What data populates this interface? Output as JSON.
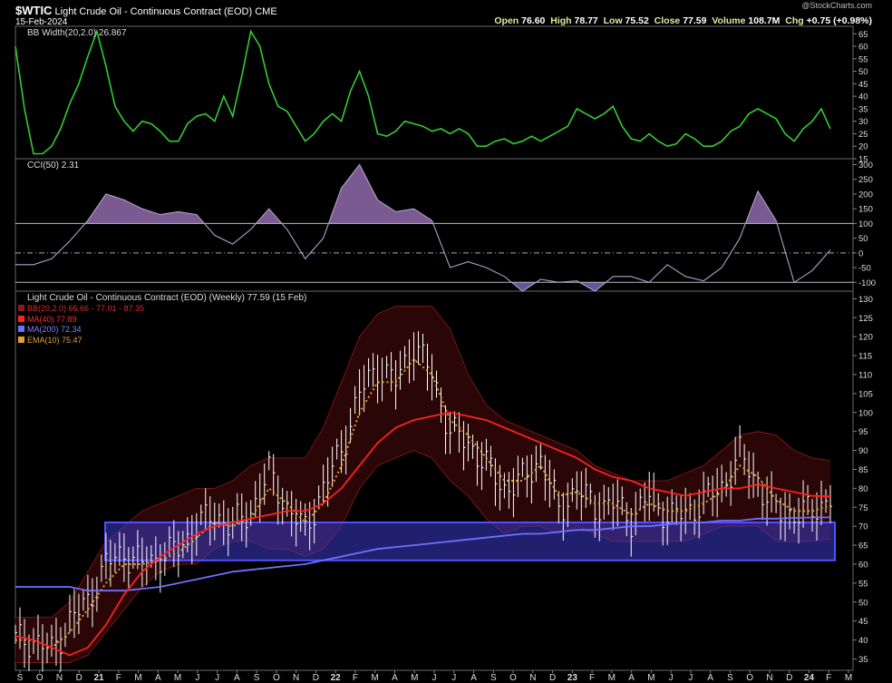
{
  "header": {
    "symbol": "$WTIC",
    "name": "Light Crude Oil - Continuous Contract (EOD)",
    "exchange": "CME",
    "date": "15-Feb-2024",
    "watermark": "@StockCharts.com",
    "quote": {
      "open_label": "Open",
      "open": "76.60",
      "high_label": "High",
      "high": "78.77",
      "low_label": "Low",
      "low": "75.52",
      "close_label": "Close",
      "close": "77.59",
      "volume_label": "Volume",
      "volume": "108.7M",
      "chg_label": "Chg",
      "chg": "+0.75 (+0.98%)"
    }
  },
  "panels": {
    "bbw": {
      "label": "BB Width(20,2.0) 26.867"
    },
    "cci": {
      "label": "CCI(50) 2.31"
    },
    "price": {
      "label": "Light Crude Oil - Continuous Contract (EOD) (Weekly) 77.59 (15 Feb)",
      "legend": [
        {
          "text": "BB(20,2.0) 66.66 - 77.01 - 87.35",
          "color": "#8b1a1a"
        },
        {
          "text": "MA(40) 77.89",
          "color": "#ff2020"
        },
        {
          "text": "MA(200) 72.34",
          "color": "#7070ff"
        },
        {
          "text": "EMA(10) 75.47",
          "color": "#e0a030"
        }
      ]
    }
  },
  "x_axis": [
    "S",
    "O",
    "N",
    "D",
    "21",
    "F",
    "M",
    "A",
    "M",
    "J",
    "J",
    "A",
    "S",
    "O",
    "N",
    "D",
    "22",
    "F",
    "M",
    "A",
    "M",
    "J",
    "J",
    "A",
    "S",
    "O",
    "N",
    "D",
    "23",
    "F",
    "M",
    "A",
    "M",
    "J",
    "J",
    "A",
    "S",
    "O",
    "N",
    "D",
    "24",
    "F",
    "M"
  ],
  "chart_data": [
    {
      "type": "line",
      "title": "BB Width(20,2.0)",
      "ylim": [
        15,
        68
      ],
      "yticks": [
        15,
        20,
        25,
        30,
        35,
        40,
        45,
        50,
        55,
        60,
        65
      ],
      "series": [
        {
          "name": "BB Width(20,2.0)",
          "color": "#33cc33",
          "x": [
            0,
            2,
            4,
            6,
            8,
            10,
            12,
            14,
            16,
            18,
            20,
            22,
            24,
            26,
            28,
            30,
            32,
            34,
            36,
            38,
            40,
            42,
            44,
            46,
            48,
            50,
            52,
            54,
            56,
            58,
            60,
            62,
            64,
            66,
            68,
            70,
            72,
            74,
            76,
            78,
            80,
            82,
            84,
            86,
            88,
            90,
            92,
            94,
            96,
            98,
            100,
            102,
            104,
            106,
            108,
            110,
            112,
            114,
            116,
            118,
            120,
            122,
            124,
            126,
            128,
            130,
            132,
            134,
            136,
            138,
            140,
            142,
            144,
            146,
            148,
            150,
            152,
            154,
            156,
            158,
            160,
            162,
            164,
            166,
            168,
            170,
            172,
            174,
            176,
            178,
            180
          ],
          "values": [
            60,
            35,
            17,
            17,
            20,
            27,
            37,
            45,
            56,
            66,
            52,
            36,
            30,
            26,
            30,
            29,
            26,
            22,
            22,
            29,
            32,
            33,
            30,
            40,
            32,
            48,
            66,
            60,
            45,
            36,
            34,
            28,
            22,
            25,
            30,
            33,
            30,
            42,
            50,
            40,
            25,
            24,
            26,
            30,
            29,
            28,
            26,
            27,
            25,
            27,
            25,
            20,
            20,
            22,
            23,
            21,
            22,
            24,
            22,
            24,
            26,
            28,
            35,
            33,
            31,
            33,
            36,
            28,
            23,
            22,
            25,
            22,
            20,
            21,
            25,
            23,
            20,
            20,
            22,
            26,
            28,
            33,
            35,
            33,
            31,
            25,
            22,
            27,
            30,
            35,
            27
          ],
          "last": 26.867
        }
      ]
    },
    {
      "type": "area",
      "title": "CCI(50)",
      "ylim": [
        -130,
        320
      ],
      "yticks": [
        -100,
        -50,
        0,
        50,
        100,
        150,
        200,
        250,
        300
      ],
      "reference_lines": [
        100,
        0,
        -100
      ],
      "series": [
        {
          "name": "CCI(50)",
          "color": "#b0a0c8",
          "x": [
            0,
            4,
            8,
            12,
            16,
            20,
            24,
            28,
            32,
            36,
            40,
            44,
            48,
            52,
            56,
            60,
            64,
            68,
            72,
            76,
            80,
            84,
            88,
            92,
            96,
            100,
            104,
            108,
            112,
            116,
            120,
            124,
            128,
            132,
            136,
            140,
            144,
            148,
            152,
            156,
            160,
            164,
            168,
            172,
            176,
            180
          ],
          "values": [
            -40,
            -40,
            -20,
            40,
            110,
            200,
            180,
            150,
            130,
            140,
            130,
            60,
            30,
            80,
            150,
            80,
            -20,
            50,
            220,
            300,
            180,
            140,
            150,
            110,
            -50,
            -30,
            -50,
            -80,
            -130,
            -90,
            -100,
            -95,
            -130,
            -80,
            -80,
            -100,
            -40,
            -80,
            -95,
            -50,
            50,
            210,
            110,
            -100,
            -60,
            10
          ],
          "last": 2.31
        }
      ]
    },
    {
      "type": "line",
      "title": "Light Crude Oil - Continuous Contract (EOD) (Weekly)",
      "ylim": [
        32,
        132
      ],
      "yticks": [
        35,
        40,
        45,
        50,
        55,
        60,
        65,
        70,
        75,
        80,
        85,
        90,
        95,
        100,
        105,
        110,
        115,
        120,
        125,
        130
      ],
      "x": [
        0,
        4,
        8,
        12,
        16,
        20,
        24,
        28,
        32,
        36,
        40,
        44,
        48,
        52,
        56,
        60,
        64,
        68,
        72,
        76,
        80,
        84,
        88,
        92,
        96,
        100,
        104,
        108,
        112,
        116,
        120,
        124,
        128,
        132,
        136,
        140,
        144,
        148,
        152,
        156,
        160,
        164,
        168,
        172,
        176,
        180
      ],
      "series": [
        {
          "name": "Light Crude Oil",
          "color": "#ffffff",
          "values": [
            40,
            40,
            37,
            45,
            50,
            60,
            63,
            60,
            62,
            64,
            70,
            73,
            70,
            74,
            84,
            75,
            69,
            80,
            90,
            105,
            112,
            108,
            118,
            110,
            95,
            92,
            86,
            80,
            82,
            88,
            74,
            80,
            75,
            76,
            72,
            78,
            73,
            73,
            77,
            80,
            89,
            81,
            74,
            73,
            74,
            77.59
          ]
        },
        {
          "name": "BB Upper",
          "color": "#8b1a1a",
          "values": [
            46,
            46,
            46,
            50,
            58,
            66,
            70,
            74,
            76,
            78,
            80,
            80,
            82,
            86,
            88,
            88,
            88,
            96,
            108,
            120,
            126,
            128,
            128,
            128,
            122,
            110,
            102,
            98,
            96,
            94,
            92,
            90,
            86,
            84,
            82,
            82,
            82,
            84,
            86,
            90,
            94,
            95,
            94,
            90,
            88,
            87.35
          ]
        },
        {
          "name": "BB Lower",
          "color": "#8b1a1a",
          "values": [
            34,
            34,
            34,
            34,
            36,
            42,
            48,
            54,
            58,
            60,
            60,
            64,
            66,
            66,
            64,
            64,
            62,
            64,
            70,
            80,
            86,
            88,
            90,
            88,
            82,
            78,
            72,
            68,
            70,
            70,
            68,
            70,
            68,
            66,
            66,
            66,
            66,
            66,
            68,
            70,
            70,
            70,
            66,
            66,
            66,
            66.66
          ]
        },
        {
          "name": "MA(40)",
          "color": "#ff2020",
          "values": [
            41,
            40,
            38,
            36,
            38,
            44,
            52,
            58,
            62,
            65,
            68,
            70,
            71,
            72,
            73,
            74,
            74,
            76,
            80,
            86,
            92,
            96,
            98,
            99,
            100,
            99,
            98,
            96,
            94,
            92,
            90,
            88,
            85,
            83,
            82,
            80,
            79,
            78,
            79,
            80,
            80,
            81,
            80,
            79,
            78,
            77.89
          ]
        },
        {
          "name": "MA(200)",
          "color": "#7070ff",
          "values": [
            54,
            54,
            54,
            54,
            53,
            53,
            53,
            53.5,
            54,
            55,
            56,
            57,
            58,
            58.5,
            59,
            59.5,
            60,
            61,
            62,
            63,
            64,
            64.5,
            65,
            65.5,
            66,
            66.5,
            67,
            67.5,
            68,
            68,
            68.5,
            69,
            69,
            69.5,
            70,
            70,
            70.5,
            71,
            71,
            71.5,
            71.5,
            72,
            72,
            72.2,
            72.3,
            72.34
          ]
        },
        {
          "name": "EMA(10)",
          "color": "#e0a030",
          "values": [
            40,
            40,
            38,
            42,
            48,
            55,
            60,
            60,
            61,
            63,
            67,
            71,
            70,
            72,
            80,
            76,
            71,
            76,
            86,
            100,
            108,
            108,
            114,
            110,
            98,
            94,
            88,
            82,
            82,
            86,
            78,
            79,
            76,
            76,
            73,
            76,
            74,
            74,
            76,
            79,
            86,
            83,
            77,
            74,
            74,
            75.47
          ]
        }
      ],
      "support_zone": {
        "from": 61,
        "to": 71,
        "color": "#3a3ac8"
      }
    }
  ]
}
